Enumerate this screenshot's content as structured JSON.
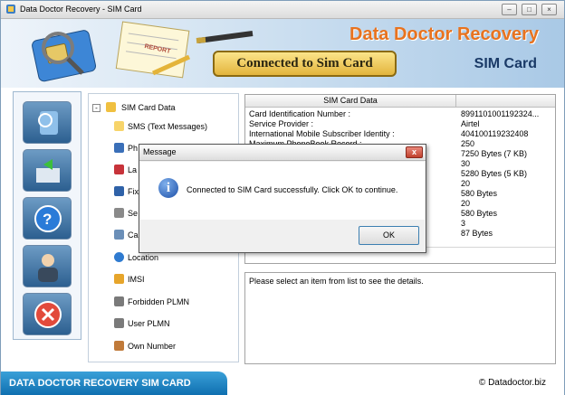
{
  "window": {
    "title": "Data Doctor Recovery - SIM Card"
  },
  "banner": {
    "brand": "Data Doctor Recovery",
    "product": "SIM Card",
    "status": "Connected to Sim Card",
    "report_label": "REPORT"
  },
  "tree": {
    "root": "SIM Card Data",
    "items": [
      {
        "label": "SMS (Text Messages)",
        "icon": "envelope-icon"
      },
      {
        "label": "Ph",
        "icon": "phonebook-icon"
      },
      {
        "label": "La",
        "icon": "last-dialed-icon"
      },
      {
        "label": "Fix",
        "icon": "fixed-dialing-icon"
      },
      {
        "label": "Se",
        "icon": "service-icon"
      },
      {
        "label": "Ca",
        "icon": "card-icon"
      },
      {
        "label": "Location",
        "icon": "globe-icon"
      },
      {
        "label": "IMSI",
        "icon": "imsi-icon"
      },
      {
        "label": "Forbidden PLMN",
        "icon": "antenna-icon"
      },
      {
        "label": "User PLMN",
        "icon": "antenna-icon"
      },
      {
        "label": "Own Number",
        "icon": "phone-icon"
      }
    ]
  },
  "grid": {
    "header": "SIM Card Data",
    "rows": [
      {
        "key": "Card Identification Number :",
        "value": "8991101001192324..."
      },
      {
        "key": "Service Provider :",
        "value": "Airtel"
      },
      {
        "key": "International Mobile Subscriber Identity :",
        "value": "404100119232408"
      },
      {
        "key": "Maximum PhoneBook Record :",
        "value": "250"
      },
      {
        "key": "",
        "value": "7250 Bytes (7 KB)"
      },
      {
        "key": "",
        "value": "30"
      },
      {
        "key": "",
        "value": "5280 Bytes (5 KB)"
      },
      {
        "key": "",
        "value": "20"
      },
      {
        "key": "",
        "value": "580 Bytes"
      },
      {
        "key": "",
        "value": "20"
      },
      {
        "key": "",
        "value": "580 Bytes"
      },
      {
        "key": "",
        "value": "3"
      },
      {
        "key": "",
        "value": "87 Bytes"
      }
    ]
  },
  "details": {
    "text": "Please select an item from list to see the details."
  },
  "footer": {
    "badge": "DATA DOCTOR RECOVERY SIM CARD",
    "copyright": "© Datadoctor.biz"
  },
  "dialog": {
    "title": "Message",
    "message": "Connected to SIM Card successfully. Click OK to continue.",
    "ok_label": "OK",
    "close_glyph": "x"
  },
  "titlebar_buttons": {
    "minimize": "–",
    "maximize": "□",
    "close": "×"
  },
  "colors": {
    "brand": "#e8731f",
    "badge": "#1f86c6",
    "banner": "#a9c9e6"
  }
}
